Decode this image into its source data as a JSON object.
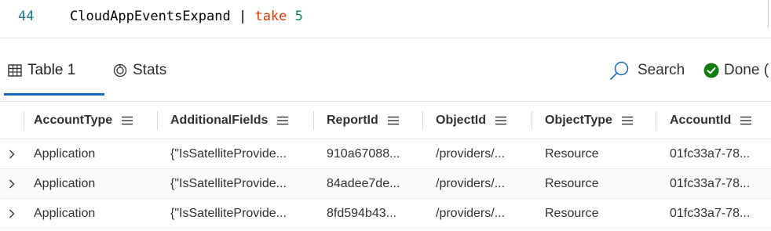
{
  "editor": {
    "line_number": "44",
    "code": {
      "table": "CloudAppEventsExpand",
      "pipe": "|",
      "operator": "take",
      "count": "5"
    }
  },
  "results_toolbar": {
    "tabs": [
      {
        "label": "Table 1",
        "icon": "table-icon",
        "selected": true
      },
      {
        "label": "Stats",
        "icon": "stats-icon",
        "selected": false
      }
    ],
    "search_label": "Search",
    "status_label": "Done (",
    "colors": {
      "accent": "#0f6cbd",
      "done_green": "#107c10"
    }
  },
  "grid": {
    "columns": [
      "AccountType",
      "AdditionalFields",
      "ReportId",
      "ObjectId",
      "ObjectType",
      "AccountId"
    ],
    "rows": [
      [
        "Application",
        "{\"IsSatelliteProvide...",
        "910a67088...",
        "/providers/...",
        "Resource",
        "01fc33a7-78..."
      ],
      [
        "Application",
        "{\"IsSatelliteProvide...",
        "84adee7de...",
        "/providers/...",
        "Resource",
        "01fc33a7-78..."
      ],
      [
        "Application",
        "{\"IsSatelliteProvide...",
        "8fd594b43...",
        "/providers/...",
        "Resource",
        "01fc33a7-78..."
      ]
    ]
  }
}
